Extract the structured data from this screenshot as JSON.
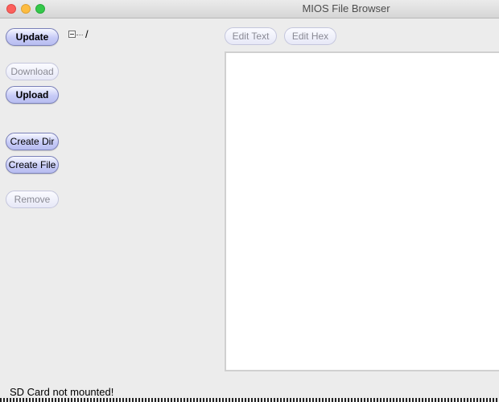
{
  "window": {
    "title": "MIOS File Browser"
  },
  "left_panel": {
    "update_label": "Update",
    "download_label": "Download",
    "upload_label": "Upload",
    "create_dir_label": "Create Dir",
    "create_file_label": "Create File",
    "remove_label": "Remove"
  },
  "tree": {
    "root_label": "/"
  },
  "editor_toolbar": {
    "edit_text_label": "Edit Text",
    "edit_hex_label": "Edit Hex"
  },
  "status": {
    "message": "SD Card not mounted!"
  }
}
